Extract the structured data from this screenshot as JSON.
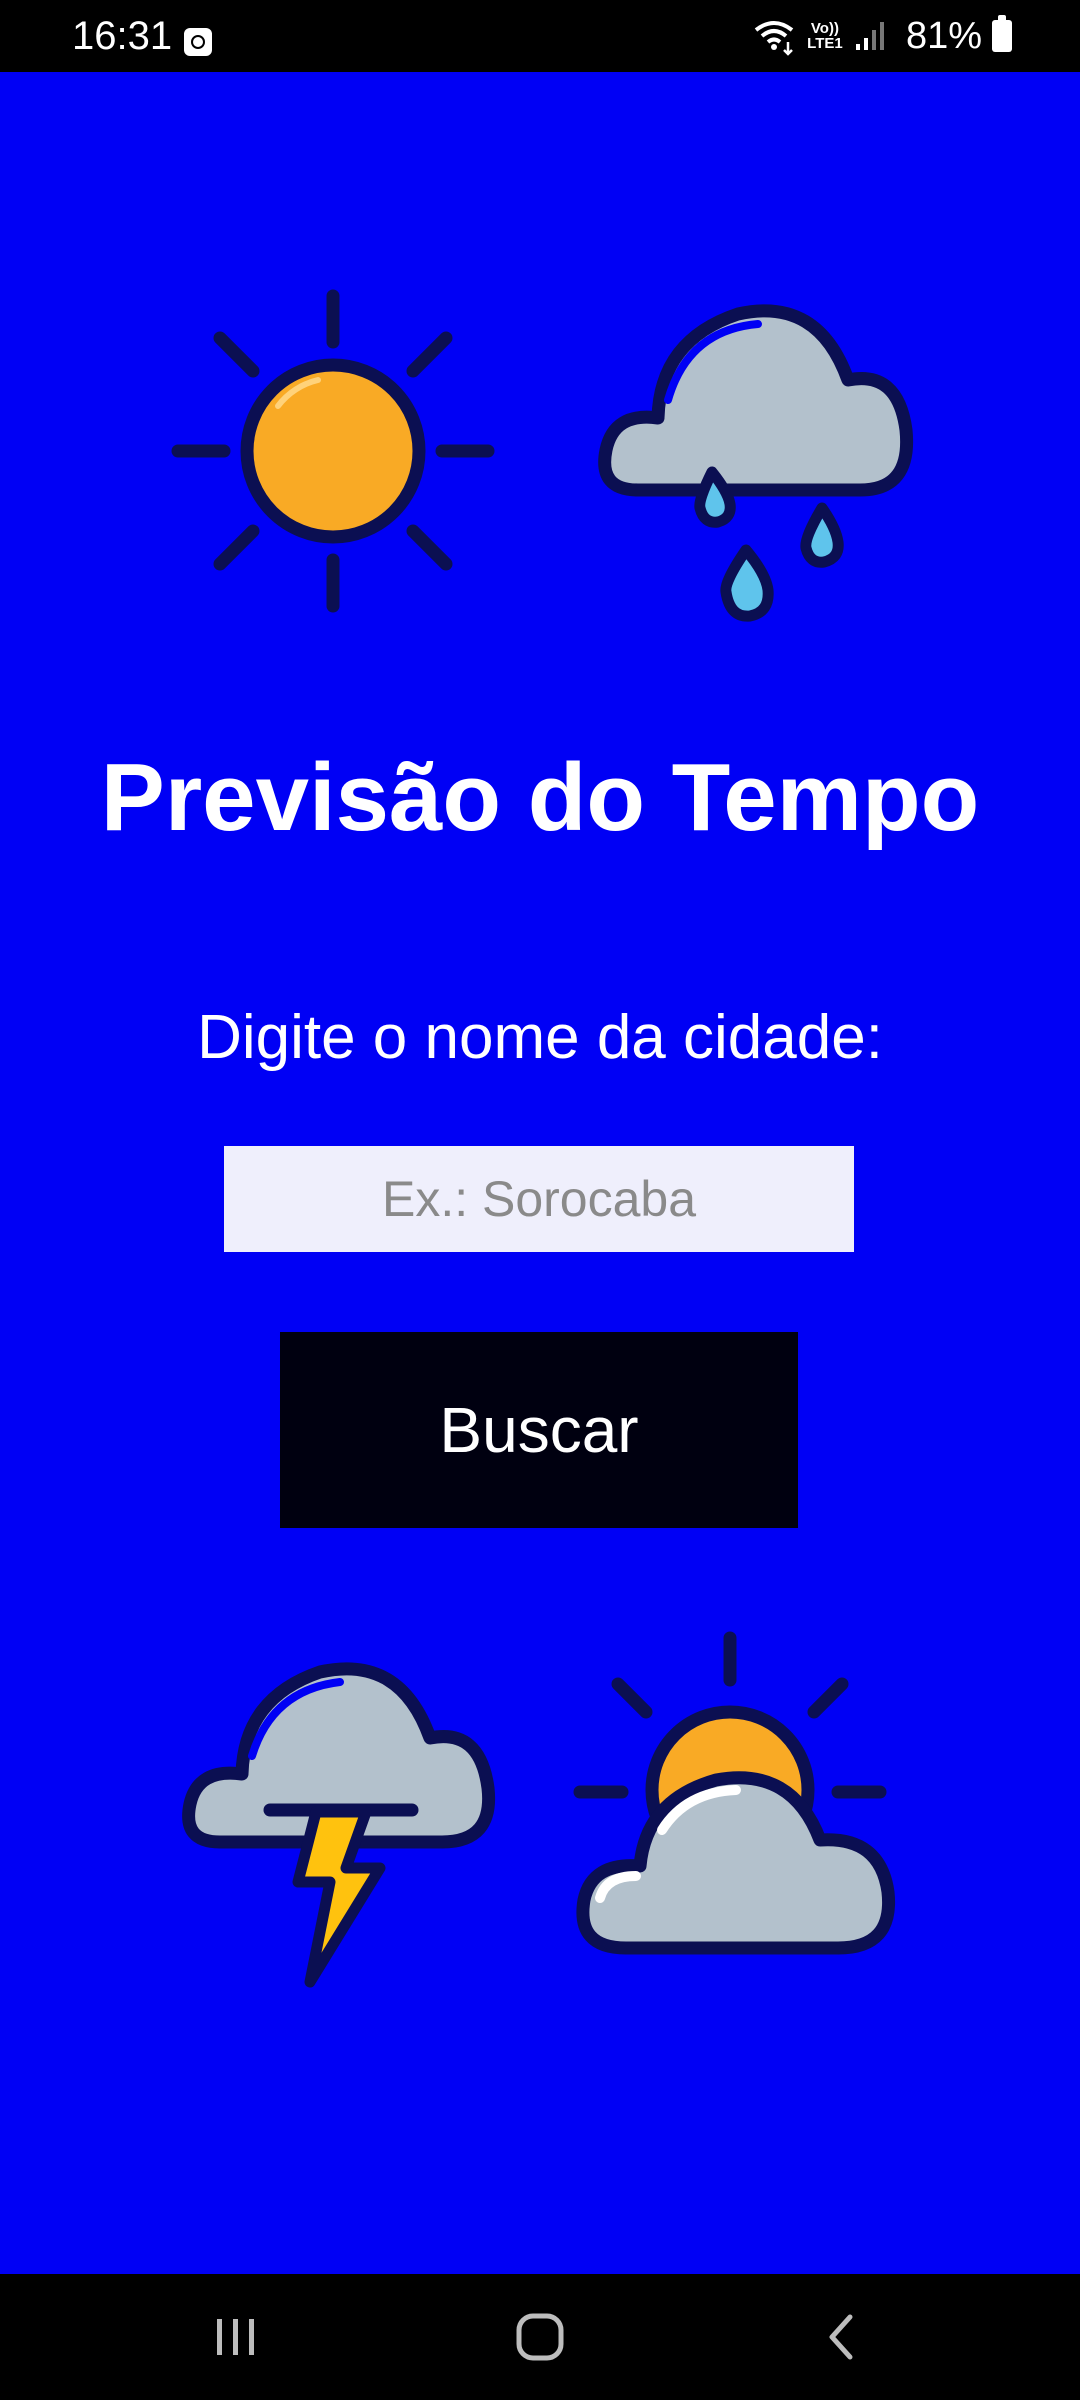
{
  "status_bar": {
    "time": "16:31",
    "network": "Vo)) LTE1",
    "battery": "81%"
  },
  "icons": {
    "top_left": "sun-icon",
    "top_right": "rain-cloud-icon",
    "bottom_left": "thunderstorm-cloud-icon",
    "bottom_right": "partly-cloudy-icon"
  },
  "colors": {
    "background": "#0000f5",
    "sun": "#f9aa25",
    "cloud": "#b3c1cc",
    "outline": "#0b0f52",
    "rain": "#5fc4ec",
    "lightning": "#ffc20e",
    "button": "#000010"
  },
  "app": {
    "title": "Previsão do Tempo",
    "prompt": "Digite o nome da cidade:",
    "city_input": {
      "value": "",
      "placeholder": "Ex.: Sorocaba"
    },
    "search_button_label": "Buscar"
  },
  "nav_bar": {
    "recents": "recents-icon",
    "home": "home-icon",
    "back": "back-icon"
  }
}
